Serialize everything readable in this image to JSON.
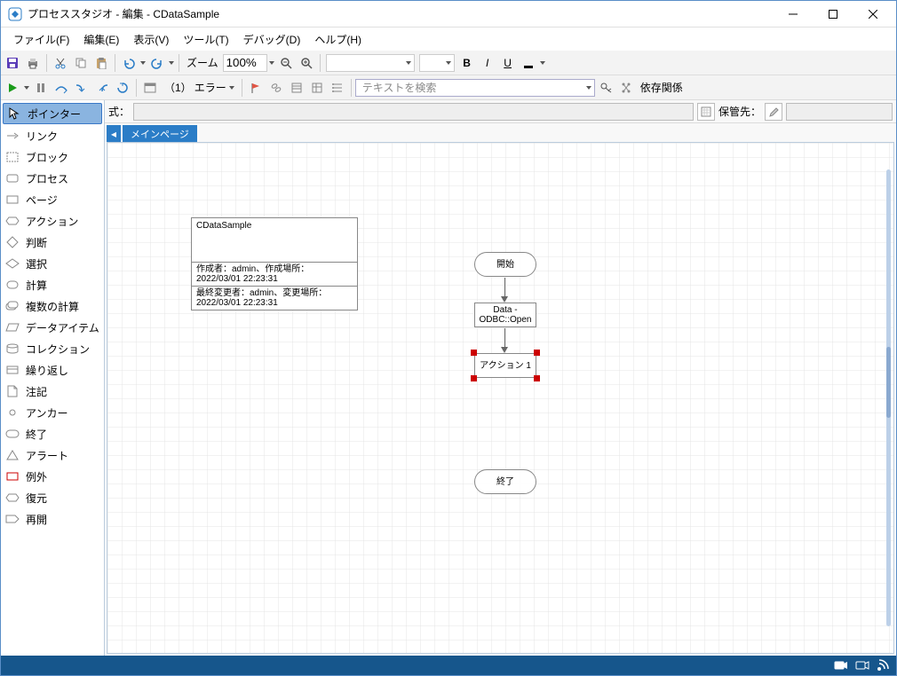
{
  "window": {
    "title": "プロセススタジオ - 編集 - CDataSample"
  },
  "menubar": {
    "file": "ファイル(F)",
    "edit": "編集(E)",
    "view": "表示(V)",
    "tools": "ツール(T)",
    "debug": "デバッグ(D)",
    "help": "ヘルプ(H)"
  },
  "toolbar1": {
    "zoom_label": "ズーム",
    "zoom_value": "100%"
  },
  "toolbar2": {
    "errors_prefix": "（1）",
    "errors_label": "エラー",
    "search_placeholder": "テキストを検索",
    "dependency_label": "依存関係"
  },
  "expressionbar": {
    "label": "式：",
    "storage_label": "保管先："
  },
  "tabs": {
    "main": "メインページ"
  },
  "palette": {
    "pointer": "ポインター",
    "link": "リンク",
    "block": "ブロック",
    "process": "プロセス",
    "page": "ページ",
    "action": "アクション",
    "decision": "判断",
    "choice": "選択",
    "calc": "計算",
    "multicalc": "複数の計算",
    "dataitem": "データアイテム",
    "collection": "コレクション",
    "loop": "繰り返し",
    "note": "注記",
    "anchor": "アンカー",
    "end": "終了",
    "alert": "アラート",
    "exception": "例外",
    "recover": "復元",
    "resume": "再開"
  },
  "canvas": {
    "info": {
      "title": "CDataSample",
      "creator_line": "作成者：admin、作成場所：",
      "created_at": "2022/03/01 22:23:31",
      "modifier_line": "最終変更者：admin、変更場所：",
      "modified_at": "2022/03/01 22:23:31"
    },
    "start": "開始",
    "data_stage": "Data - ODBC::Open",
    "action_stage": "アクション 1",
    "end": "終了"
  }
}
